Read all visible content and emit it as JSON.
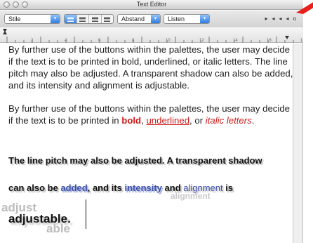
{
  "window": {
    "title": "Text Editor"
  },
  "toolbar": {
    "style_popup": "Stile",
    "spacing_popup": "Abstand",
    "list_popup": "Listen",
    "nav_buttons": [
      "▸",
      "◂",
      "◂",
      "◂",
      "o"
    ]
  },
  "ruler": {
    "numbers": [
      "2",
      "4",
      "6",
      "8",
      "10",
      "12",
      "14",
      "16",
      "18"
    ]
  },
  "content": {
    "para1": "By further use of the buttons within the palettes, the user may decide if the text is to be printed in bold, underlined, or italic letters. The line pitch may also be adjusted. A transparent shadow can also be added, and its intensity and alignment is adjustable.",
    "para2_start": "By further use of the buttons within the palettes, the user may decide if the text is to be printed in ",
    "para2_bold": "bold",
    "para2_sep1": ", ",
    "para2_underlined": "underlined",
    "para2_sep2": ", or ",
    "para2_italic": "italic letters",
    "para2_end": ".",
    "para3": "The line pitch may also be adjusted. A transparent shadow",
    "para4_a": "can also be ",
    "para4_added": "added",
    "para4_b": ", and its ",
    "para4_intensity": "intensity",
    "para4_c": " and ",
    "para4_alignment": "alignment",
    "para4_d": " is",
    "para5": "adjustable.",
    "ghost_alignment": "alignment",
    "ghost_adjust": "adjust",
    "ghost_able": "able"
  },
  "colors": {
    "accent_red": "#cc1a1a",
    "accent_blue": "#3b4ea8",
    "corner_arrow": "#e8201c"
  }
}
